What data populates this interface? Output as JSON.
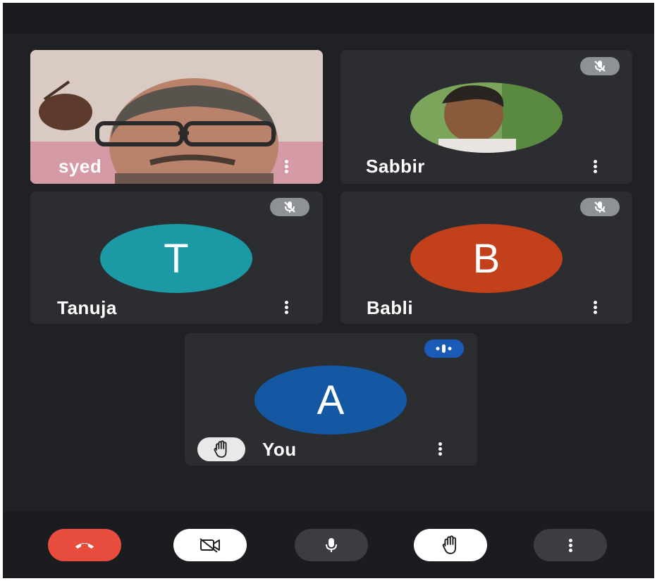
{
  "participants": [
    {
      "name": "syed",
      "video": "on",
      "muted": false
    },
    {
      "name": "Sabbir",
      "video": "profile-photo",
      "muted": true
    },
    {
      "name": "Tanuja",
      "initial": "T",
      "avatar_color": "#1b9aa6",
      "muted": true
    },
    {
      "name": "Babli",
      "initial": "B",
      "avatar_color": "#c2401a",
      "muted": true
    },
    {
      "name": "You",
      "initial": "A",
      "avatar_color": "#1457a3",
      "speaking": true,
      "hand_raised": true
    }
  ],
  "controls": [
    {
      "icon": "phone-hangup-icon",
      "color": "#e84c3d"
    },
    {
      "icon": "video-off-icon",
      "color": "#ffffff"
    },
    {
      "icon": "microphone-icon",
      "color": "#3b3d42"
    },
    {
      "icon": "raise-hand-icon",
      "color": "#ffffff"
    },
    {
      "icon": "more-vert-icon",
      "color": "#3b3d42"
    }
  ]
}
